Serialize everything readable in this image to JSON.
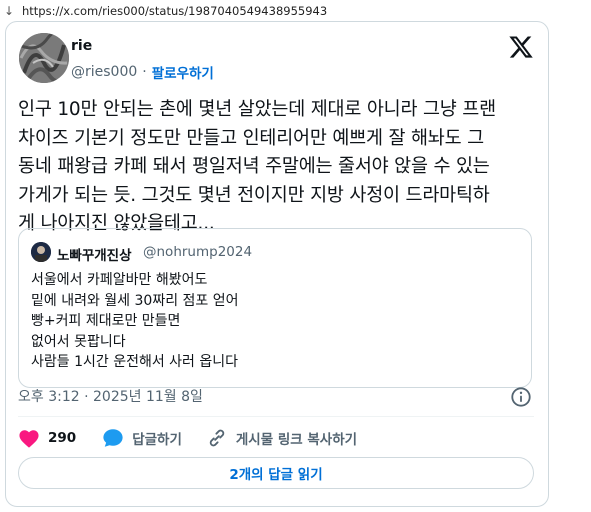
{
  "browser": {
    "url": "https://x.com/ries000/status/1987040549438955943"
  },
  "author": {
    "name": "rie",
    "handle": "@ries000",
    "follow_label": "팔로우하기"
  },
  "tweet": {
    "lines": [
      "인구 10만 안되는 촌에 몇년 살았는데 제대로 아니라 그냥 프랜",
      "차이즈 기본기 정도만 만들고 인테리어만 예쁘게 잘 해놔도 그",
      "동네 패왕급 카페 돼서 평일저녁 주말에는 줄서야 앉을 수 있는",
      "가게가 되는 듯. 그것도 몇년 전이지만 지방 사정이 드라마틱하",
      "게 나아지진 않았을테고..."
    ],
    "timestamp": "오후 3:12 · 2025년 11월 8일"
  },
  "quoted": {
    "name": "노빠꾸개진상",
    "handle": "@nohrump2024",
    "lines": [
      "서울에서 카페알바만 해봤어도",
      "밑에 내려와 월세 30짜리 점포 얻어",
      "빵+커피 제대로만 만들면",
      "없어서 못팝니다",
      "사람들 1시간 운전해서 사러 옵니다"
    ]
  },
  "actions": {
    "like_count": "290",
    "reply_label": "답글하기",
    "copy_link_label": "게시물 링크 복사하기"
  },
  "footer": {
    "read_replies_label": "2개의 답글 읽기"
  },
  "colors": {
    "accent": "#006fd6",
    "like": "#f91880",
    "reply": "#1d9bf0",
    "muted": "#536471",
    "border": "#cfd9de"
  },
  "icons": {
    "back": "download-arrow-icon",
    "logo": "x-logo-icon",
    "info": "info-icon",
    "like": "heart-icon",
    "reply": "speech-bubble-icon",
    "link": "link-icon"
  }
}
